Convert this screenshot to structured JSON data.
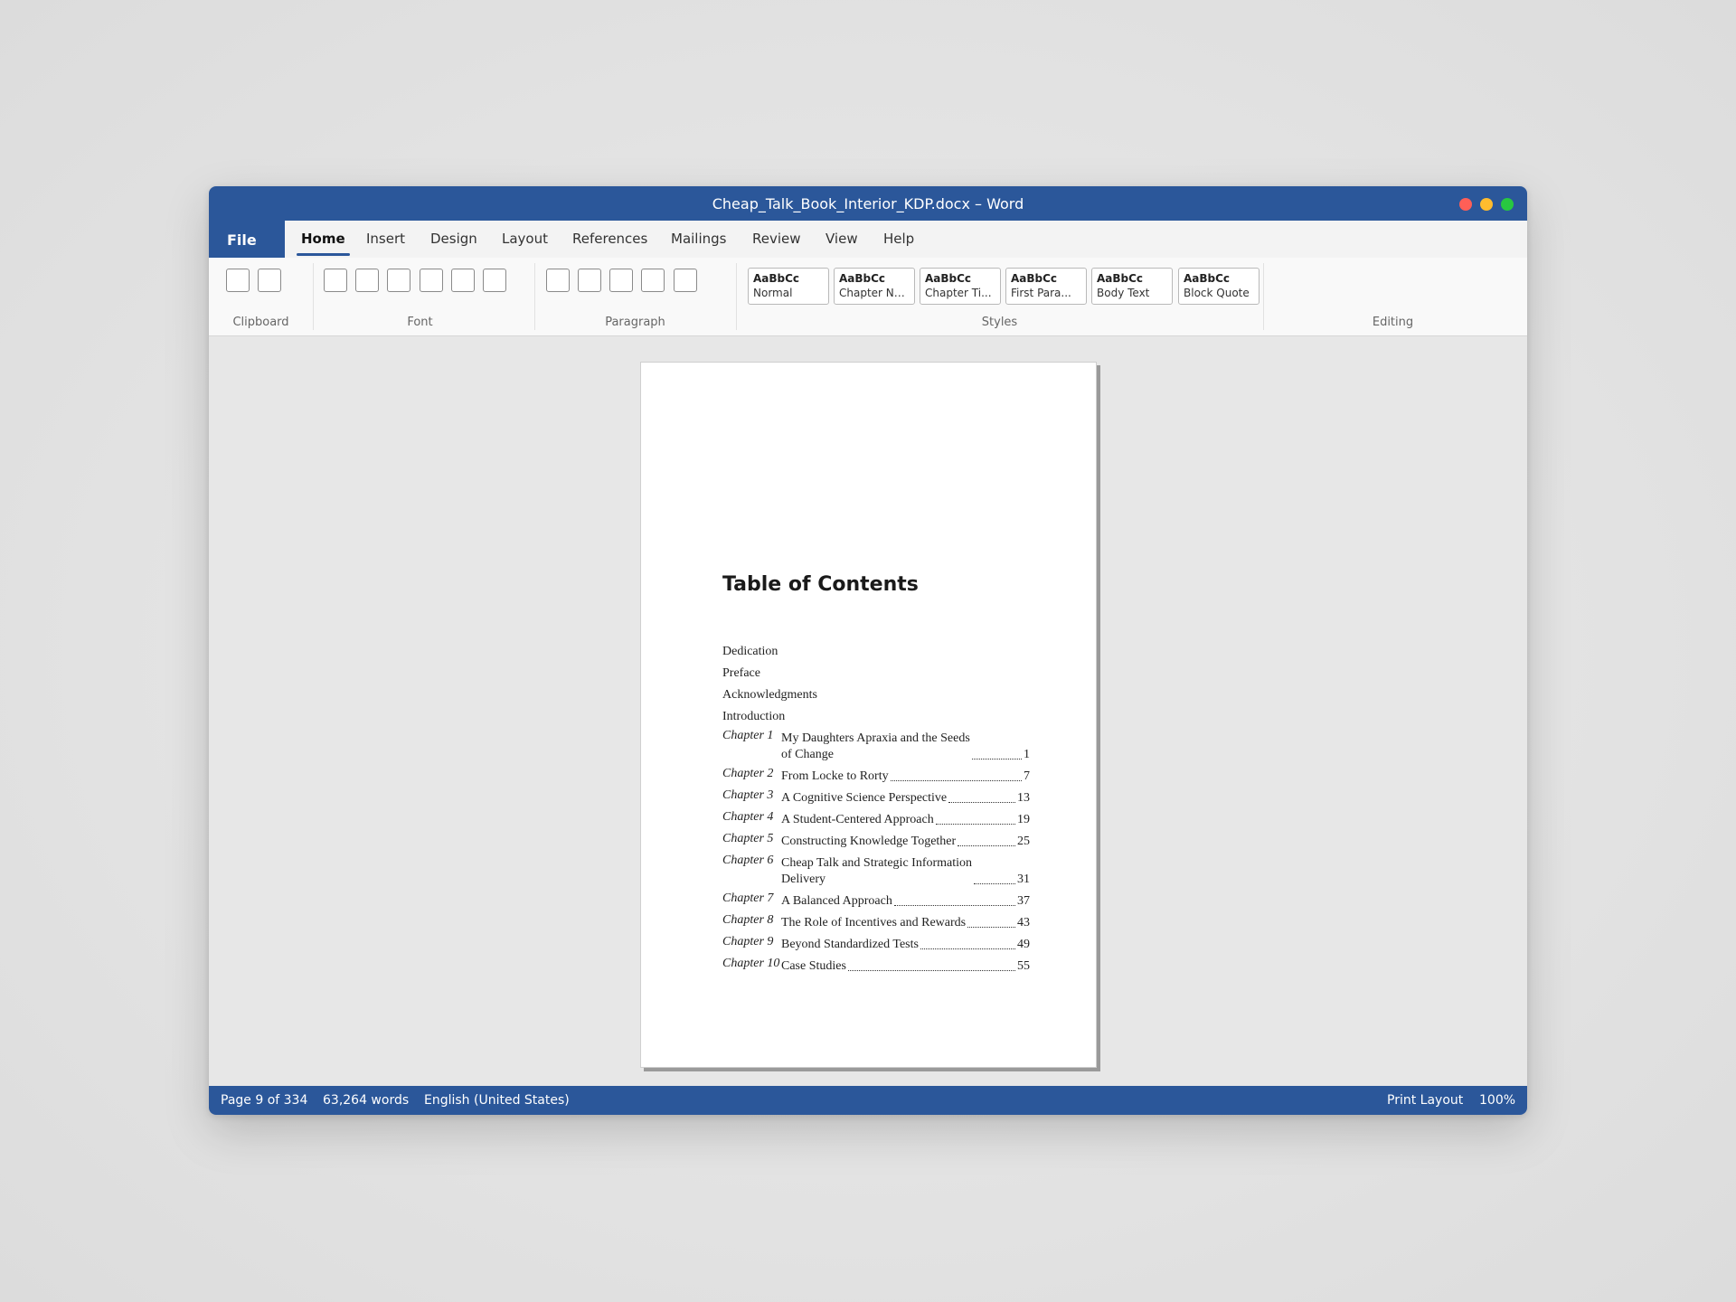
{
  "window": {
    "title": "Cheap_Talk_Book_Interior_KDP.docx – Word"
  },
  "tabs": {
    "file": "File",
    "items": [
      "Home",
      "Insert",
      "Design",
      "Layout",
      "References",
      "Mailings",
      "Review",
      "View",
      "Help"
    ],
    "active": "Home"
  },
  "ribbon": {
    "groups": {
      "clipboard": "Clipboard",
      "font": "Font",
      "paragraph": "Paragraph",
      "styles": "Styles",
      "editing": "Editing"
    },
    "styles": [
      {
        "sample": "AaBbCc",
        "name": "Normal"
      },
      {
        "sample": "AaBbCc",
        "name": "Chapter Nu..."
      },
      {
        "sample": "AaBbCc",
        "name": "Chapter Ti..."
      },
      {
        "sample": "AaBbCc",
        "name": "First Para..."
      },
      {
        "sample": "AaBbCc",
        "name": "Body Text"
      },
      {
        "sample": "AaBbCc",
        "name": "Block Quote"
      }
    ]
  },
  "document": {
    "title": "Table of Contents",
    "front_matter": [
      "Dedication",
      "Preface",
      "Acknowledgments",
      "Introduction"
    ],
    "chapters": [
      {
        "label": "Chapter 1",
        "line1": "My Daughters Apraxia and the Seeds",
        "line2": "of Change",
        "page": "1"
      },
      {
        "label": "Chapter 2",
        "line1": "From Locke to Rorty",
        "page": "7"
      },
      {
        "label": "Chapter 3",
        "line1": "A Cognitive Science Perspective",
        "page": "13"
      },
      {
        "label": "Chapter 4",
        "line1": "A Student-Centered Approach",
        "page": "19"
      },
      {
        "label": "Chapter 5",
        "line1": "Constructing Knowledge Together",
        "page": "25"
      },
      {
        "label": "Chapter 6",
        "line1": "Cheap Talk and Strategic Information",
        "line2": "Delivery",
        "page": "31"
      },
      {
        "label": "Chapter 7",
        "line1": "A Balanced Approach",
        "page": "37"
      },
      {
        "label": "Chapter 8",
        "line1": "The Role of Incentives and Rewards",
        "page": "43"
      },
      {
        "label": "Chapter 9",
        "line1": "Beyond Standardized Tests",
        "page": "49"
      },
      {
        "label": "Chapter 10",
        "line1": "Case Studies",
        "page": "55"
      }
    ]
  },
  "status": {
    "page": "Page 9 of 334",
    "words": "63,264 words",
    "language": "English (United States)",
    "view": "Print Layout",
    "zoom": "100%"
  },
  "colors": {
    "accent": "#2b579a"
  }
}
